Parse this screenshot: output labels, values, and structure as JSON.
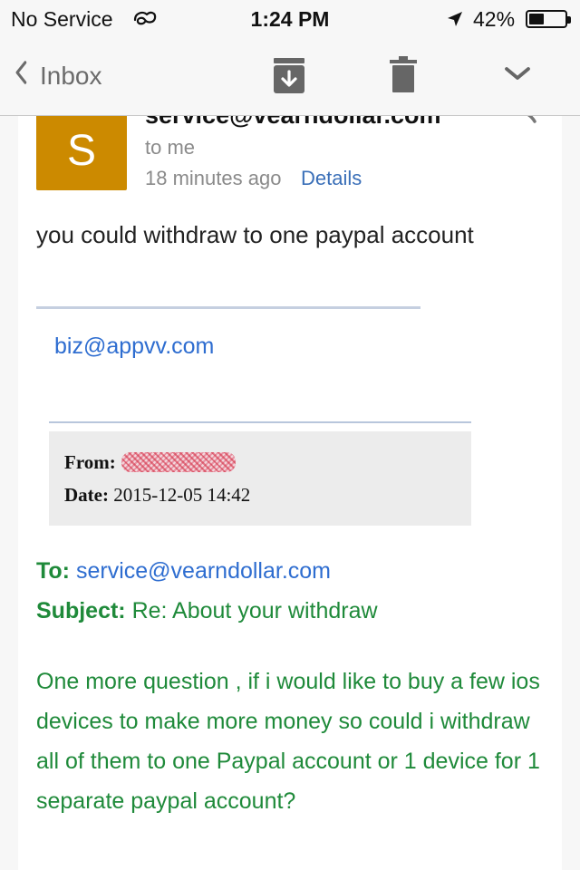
{
  "status_bar": {
    "carrier": "No Service",
    "time": "1:24 PM",
    "battery_percent": "42%",
    "battery_level": 0.42
  },
  "nav": {
    "back_label": "Inbox",
    "icons": [
      "archive-icon",
      "trash-icon",
      "chevron-down-icon"
    ]
  },
  "message": {
    "sender": "service@vearndollar.com",
    "avatar_letter": "S",
    "recipient": "to me",
    "time_ago": "18 minutes ago",
    "details_link": "Details",
    "body": "you could withdraw to one paypal account",
    "signature_email": "biz@appvv.com",
    "quoted": {
      "from_label": "From:",
      "date_label": "Date:",
      "date_value": "2015-12-05 14:42"
    },
    "to_label": "To:",
    "to_value": "service@vearndollar.com",
    "subject_label": "Subject:",
    "subject_value": "Re: About your withdraw",
    "question": "One more question , if i would like to buy a few ios devices to make more money so could i withdraw all of them to one Paypal account or 1 device for 1 separate paypal account?"
  },
  "colors": {
    "avatar": "#cc8a00",
    "link": "#2e6dd0",
    "quote_green": "#1f8a3a"
  }
}
